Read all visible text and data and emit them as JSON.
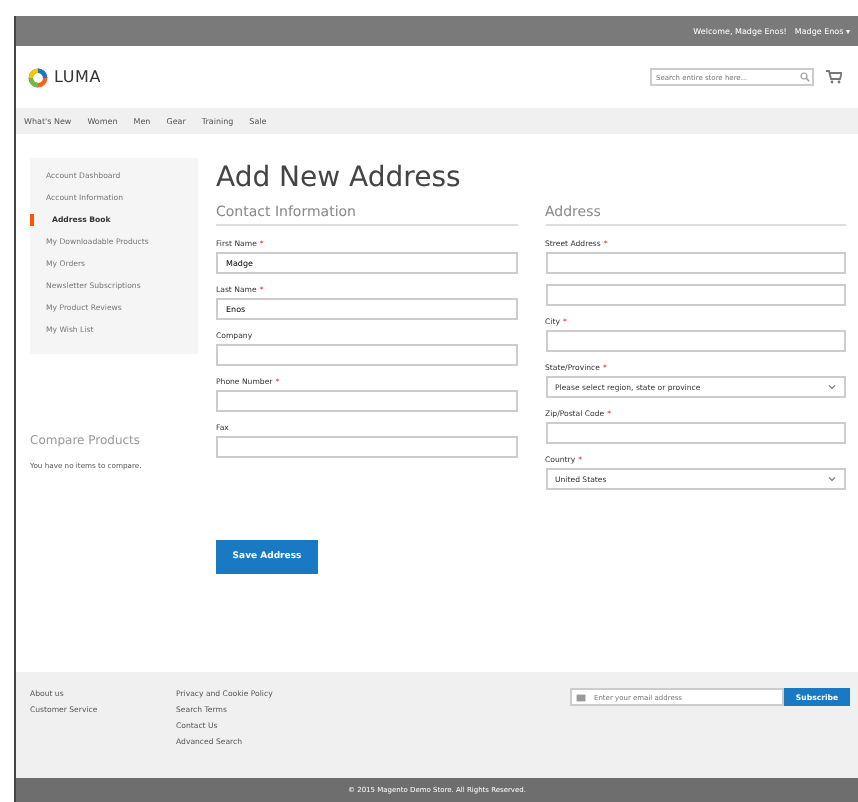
{
  "top_bar": {
    "welcome": "Welcome, Madge Enos!",
    "account": "Madge Enos ▾"
  },
  "header": {
    "logo": "LUMA",
    "search": {
      "placeholder": "Search entire store here..."
    }
  },
  "nav": [
    "What's New",
    "Women",
    "Men",
    "Gear",
    "Training",
    "Sale"
  ],
  "sidebar": {
    "items": [
      {
        "label": "Account Dashboard",
        "selected": false
      },
      {
        "label": "Account Information",
        "selected": false
      },
      {
        "label": "Address Book",
        "selected": true
      },
      {
        "label": "My Downloadable Products",
        "selected": false
      },
      {
        "label": "My Orders",
        "selected": false
      },
      {
        "label": "Newsletter Subscriptions",
        "selected": false
      },
      {
        "label": "My Product Reviews",
        "selected": false
      },
      {
        "label": "My Wish List",
        "selected": false
      }
    ],
    "compare": {
      "title": "Compare Products",
      "empty": "You have no items to compare."
    }
  },
  "page_title": "Add New Address",
  "contact": {
    "title": "Contact Information",
    "fields": [
      {
        "label": "First Name",
        "mark": "*",
        "value": "Madge"
      },
      {
        "label": "Last Name",
        "mark": "*",
        "value": "Enos"
      },
      {
        "label": "Company"
      },
      {
        "label": "Phone Number",
        "mark": "*"
      },
      {
        "label": "Fax"
      }
    ]
  },
  "address": {
    "title": "Address",
    "fields": [
      {
        "kind": "street",
        "label": "Street Address",
        "mark": "*"
      },
      {
        "kind": "text",
        "label": "City",
        "mark": "*"
      },
      {
        "kind": "select",
        "label": "State/Province",
        "mark": "*",
        "value": "Please select region, state or province"
      },
      {
        "kind": "text",
        "label": "Zip/Postal Code",
        "mark": "*"
      },
      {
        "kind": "select",
        "label": "Country",
        "mark": "*",
        "value": "United States"
      }
    ]
  },
  "save_button": "Save Address",
  "footer": {
    "column_1": [
      "About us",
      "Customer Service"
    ],
    "column_2": [
      "Privacy and Cookie Policy",
      "Search Terms",
      "Contact Us",
      "Advanced Search"
    ],
    "newsletter": {
      "placeholder": "Enter your email address",
      "button": "Subscribe"
    }
  },
  "copyright": "© 2015 Magento Demo Store. All Rights Reserved."
}
